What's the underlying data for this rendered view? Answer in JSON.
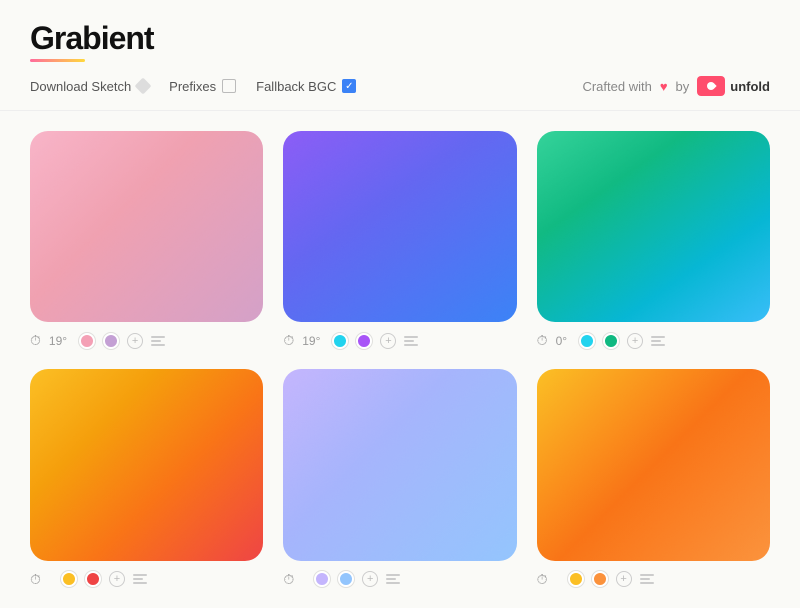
{
  "header": {
    "logo": "Grabient",
    "logo_underline_color": "#ff6b9d"
  },
  "toolbar": {
    "download_sketch_label": "Download Sketch",
    "prefixes_label": "Prefixes",
    "fallback_bgc_label": "Fallback BGC",
    "fallback_checked": true,
    "crafted_with_label": "Crafted with",
    "by_label": "by",
    "brand_label": "unfold"
  },
  "gradients": [
    {
      "id": 1,
      "angle": "19°",
      "colors": [
        "#f4a0b5",
        "#c4a0d4"
      ],
      "class": "gradient-1"
    },
    {
      "id": 2,
      "angle": "19°",
      "colors": [
        "#22d3ee",
        "#a855f7"
      ],
      "class": "gradient-2"
    },
    {
      "id": 3,
      "angle": "0°",
      "colors": [
        "#22d3ee",
        "#10b981"
      ],
      "class": "gradient-3"
    },
    {
      "id": 4,
      "angle": "",
      "colors": [
        "#fbbf24",
        "#ef4444"
      ],
      "class": "gradient-4"
    },
    {
      "id": 5,
      "angle": "",
      "colors": [
        "#c4b5fd",
        "#93c5fd"
      ],
      "class": "gradient-5"
    },
    {
      "id": 6,
      "angle": "",
      "colors": [
        "#fbbf24",
        "#fb923c"
      ],
      "class": "gradient-6"
    }
  ]
}
